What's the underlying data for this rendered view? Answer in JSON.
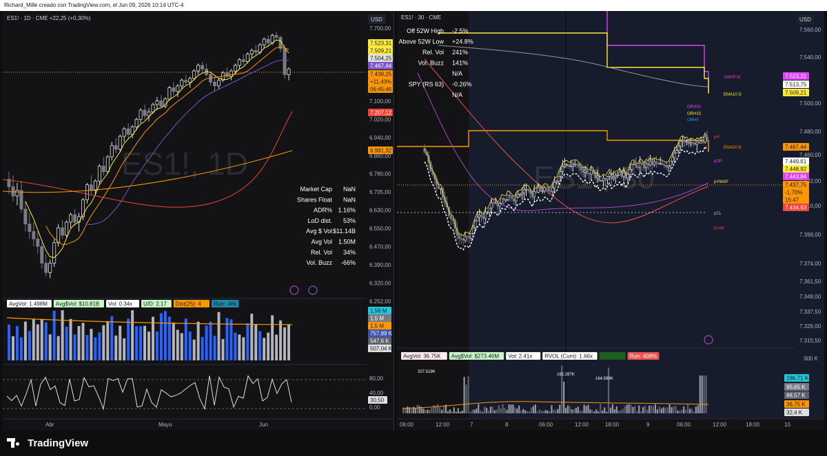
{
  "header": {
    "text": "Richard_Mille creado con TradingView.com, el Jun 09, 2026 10:14 UTC-4"
  },
  "footer": {
    "brand": "TradingView"
  },
  "left": {
    "symbol": "ES1! · 1D · CME  +22,25 (+0,30%)",
    "watermark": "ES1!, 1D",
    "currency": "USD",
    "price_ticks": [
      "7.700,00",
      "7.580,00",
      "7.440,00",
      "7.300,00",
      "7.100,00",
      "7.020,00",
      "6.940,00",
      "6.860,00",
      "6.780,00",
      "6.705,00",
      "6.630,00",
      "6.550,00",
      "6.470,00",
      "6.390,00",
      "6.320,00",
      "6.252,00"
    ],
    "price_labels": [
      {
        "text": "7.523,31",
        "bg": "#ffeb3b",
        "fg": "#131722"
      },
      {
        "text": "7.509,21",
        "bg": "#ffeb3b",
        "fg": "#131722"
      },
      {
        "text": "7.504,25",
        "bg": "#e0e0e0",
        "fg": "#131722"
      },
      {
        "text": "7.467,44",
        "bg": "#7e57c2",
        "fg": "#ffffff"
      },
      {
        "text": "7.438,25",
        "bg": "#ff9800",
        "fg": "#131722"
      },
      {
        "text": "+11,43%",
        "bg": "#ff9800",
        "fg": "#131722"
      },
      {
        "text": "06:45:46",
        "bg": "#ff9800",
        "fg": "#131722"
      },
      {
        "text": "7.207,12",
        "bg": "#f44336",
        "fg": "#ffffff"
      },
      {
        "text": "6.991,32",
        "bg": "#ff9800",
        "fg": "#131722"
      }
    ],
    "stats": [
      {
        "label": "Market Cap",
        "value": "NaN"
      },
      {
        "label": "Shares Float",
        "value": "NaN"
      },
      {
        "label": "ADR%",
        "value": "1.16%"
      },
      {
        "label": "LoD dist.",
        "value": "53%"
      },
      {
        "label": "Avg $ Vol",
        "value": "$11.14B"
      },
      {
        "label": "Avg Vol",
        "value": "1.50M"
      },
      {
        "label": "Rel. Vol",
        "value": "34%"
      },
      {
        "label": "Vol. Buzz",
        "value": "-66%"
      }
    ],
    "vol_badges": [
      {
        "text": "AvgVol: 1.498M",
        "bg": "#ffffff",
        "fg": "#131722"
      },
      {
        "text": "Avg$Vol: $10.81B",
        "bg": "#c8f7c5",
        "fg": "#131722"
      },
      {
        "text": "Vol: 0.34x",
        "bg": "#ffffff",
        "fg": "#131722"
      },
      {
        "text": "U/D: 2.17",
        "bg": "#c8f7c5",
        "fg": "#131722"
      },
      {
        "text": "Dist(25): 4",
        "bg": "#ff9800",
        "fg": "#131722"
      },
      {
        "text": "Run: -4%",
        "bg": "#1e88a8",
        "fg": "#131722"
      }
    ],
    "vol_labels": [
      {
        "text": "1,56 M",
        "bg": "#26c6da",
        "fg": "#131722"
      },
      {
        "text": "1,5 M",
        "bg": "#787b86",
        "fg": "#ffffff"
      },
      {
        "text": "1,5 M",
        "bg": "#ff9800",
        "fg": "#131722"
      },
      {
        "text": "757,89 K",
        "bg": "#3f51b5",
        "fg": "#ffffff"
      },
      {
        "text": "547,6 K",
        "bg": "#5d606b",
        "fg": "#ffffff"
      },
      {
        "text": "507,04 K",
        "bg": "#e0e0e0",
        "fg": "#131722"
      }
    ],
    "osc_ticks": [
      "80,00",
      "40,00",
      "0,00"
    ],
    "osc_label": "30,50",
    "x_labels": [
      "Abr",
      "Mayo",
      "Jun"
    ]
  },
  "right": {
    "symbol": "ES1! · 30 · CME",
    "watermark": "ES1!, 30",
    "currency": "USD",
    "price_ticks": [
      "7.560,00",
      "7.540,00",
      "7.500,00",
      "7.480,00",
      "7.460,00",
      "7.422,00",
      "7.410,00",
      "7.398,00",
      "7.374,00",
      "7.361,50",
      "7.349,00",
      "7.337,50",
      "7.326,00",
      "7.315,50"
    ],
    "price_labels": [
      {
        "text": "7.523,31",
        "bg": "#e040fb",
        "fg": "#ffffff"
      },
      {
        "text": "7.513,75",
        "bg": "#ffffff",
        "fg": "#131722"
      },
      {
        "text": "7.509,21",
        "bg": "#ffeb3b",
        "fg": "#131722"
      },
      {
        "text": "7.467,44",
        "bg": "#ff9800",
        "fg": "#131722"
      },
      {
        "text": "7.449,61",
        "bg": "#ffffff",
        "fg": "#131722"
      },
      {
        "text": "7.448,92",
        "bg": "#ffeb3b",
        "fg": "#131722"
      },
      {
        "text": "7.443,84",
        "bg": "#e040fb",
        "fg": "#ffffff"
      },
      {
        "text": "7.437,75",
        "bg": "#ff9800",
        "fg": "#131722"
      },
      {
        "text": "-1,70%",
        "bg": "#ff9800",
        "fg": "#131722"
      },
      {
        "text": "15:47",
        "bg": "#ff9800",
        "fg": "#131722"
      },
      {
        "text": "7.434,63",
        "bg": "#f44336",
        "fg": "#ffffff"
      }
    ],
    "stats": [
      {
        "label": "Off 52W High",
        "value": "-2.5%"
      },
      {
        "label": "Above 52W Low",
        "value": "+24.8%"
      },
      {
        "label": "Rel. Vol",
        "value": "241%"
      },
      {
        "label": "Vol. Buzz",
        "value": "141%"
      },
      {
        "label": "",
        "value": "N/A"
      },
      {
        "label": "SPY (RS 63)",
        "value": "-0.26%"
      },
      {
        "label": "",
        "value": "N/A"
      }
    ],
    "level_tags": [
      {
        "text": "VWAP M",
        "color": "#e040fb"
      },
      {
        "text": "EMA10 D",
        "color": "#ffeb3b"
      },
      {
        "text": "ORH30",
        "color": "#e040fb"
      },
      {
        "text": "ORH15",
        "color": "#ffeb3b"
      },
      {
        "text": "ORH5",
        "color": "#2196f3"
      },
      {
        "text": "pH",
        "color": "#f44336"
      },
      {
        "text": "EMA20 D",
        "color": "#ff9800"
      },
      {
        "text": "pOP",
        "color": "#e040fb"
      },
      {
        "text": "pVWAP",
        "color": "#ffeb3b"
      },
      {
        "text": "pCL",
        "color": "#b2b5be"
      },
      {
        "text": "pLow",
        "color": "#f44336"
      }
    ],
    "vol_badges": [
      {
        "text": "AvgVol: 36.75K",
        "bg": "#ffebee",
        "fg": "#131722"
      },
      {
        "text": "Avg$Vol: $273.46M",
        "bg": "#c8f7c5",
        "fg": "#131722"
      },
      {
        "text": "Vol: 2.41x",
        "bg": "#ffffff",
        "fg": "#131722"
      },
      {
        "text": "RVOL (Cum): 1.66x",
        "bg": "#ffffff",
        "fg": "#131722"
      },
      {
        "text": "",
        "bg": "#1b5e20",
        "fg": "#131722"
      },
      {
        "text": "Run: 408%",
        "bg": "#ef5350",
        "fg": "#ffffff"
      }
    ],
    "vol_annotations": [
      "207.519K",
      "192.287K",
      "164.599K"
    ],
    "vol_scale": "300 K",
    "vol_labels": [
      {
        "text": "186,71 K",
        "bg": "#26c6da",
        "fg": "#131722"
      },
      {
        "text": "95,65 K",
        "bg": "#787b86",
        "fg": "#ffffff"
      },
      {
        "text": "88,57 K",
        "bg": "#5d606b",
        "fg": "#ffffff"
      },
      {
        "text": "36,75 K",
        "bg": "#ff9800",
        "fg": "#131722"
      },
      {
        "text": "32,4 K",
        "bg": "#e0e0e0",
        "fg": "#131722"
      }
    ],
    "x_labels": [
      "06:00",
      "12:00",
      "7",
      "8",
      "06:00",
      "12:00",
      "18:00",
      "9",
      "06:00",
      "12:00",
      "18:00",
      "10"
    ]
  },
  "chart_data": [
    {
      "type": "candlestick",
      "title": "ES1!, 1D",
      "ylim": [
        6252,
        7700
      ],
      "series_ohlc": [
        [
          6880,
          6920,
          6800,
          6840
        ],
        [
          6840,
          6900,
          6760,
          6790
        ],
        [
          6790,
          6860,
          6740,
          6820
        ],
        [
          6820,
          6870,
          6700,
          6720
        ],
        [
          6720,
          6760,
          6600,
          6640
        ],
        [
          6640,
          6700,
          6560,
          6600
        ],
        [
          6600,
          6650,
          6520,
          6560
        ],
        [
          6560,
          6600,
          6480,
          6520
        ],
        [
          6520,
          6540,
          6400,
          6430
        ],
        [
          6430,
          6480,
          6360,
          6380
        ],
        [
          6380,
          6450,
          6350,
          6430
        ],
        [
          6430,
          6560,
          6410,
          6540
        ],
        [
          6540,
          6640,
          6520,
          6620
        ],
        [
          6620,
          6660,
          6560,
          6580
        ],
        [
          6580,
          6660,
          6570,
          6650
        ],
        [
          6650,
          6700,
          6620,
          6690
        ],
        [
          6690,
          6720,
          6630,
          6650
        ],
        [
          6650,
          6700,
          6600,
          6680
        ],
        [
          6680,
          6780,
          6660,
          6770
        ],
        [
          6770,
          6860,
          6750,
          6850
        ],
        [
          6850,
          6900,
          6800,
          6820
        ],
        [
          6820,
          6880,
          6790,
          6870
        ],
        [
          6870,
          6960,
          6850,
          6950
        ],
        [
          6950,
          7000,
          6900,
          6920
        ],
        [
          6920,
          7010,
          6910,
          7000
        ],
        [
          7000,
          7080,
          6980,
          7060
        ],
        [
          7060,
          7100,
          7020,
          7040
        ],
        [
          7040,
          7120,
          7030,
          7110
        ],
        [
          7110,
          7160,
          7080,
          7150
        ],
        [
          7150,
          7180,
          7100,
          7120
        ],
        [
          7120,
          7170,
          7100,
          7160
        ],
        [
          7160,
          7210,
          7140,
          7200
        ],
        [
          7200,
          7260,
          7180,
          7250
        ],
        [
          7250,
          7280,
          7200,
          7220
        ],
        [
          7220,
          7260,
          7190,
          7240
        ],
        [
          7240,
          7290,
          7230,
          7280
        ],
        [
          7280,
          7320,
          7250,
          7300
        ],
        [
          7300,
          7330,
          7260,
          7270
        ],
        [
          7270,
          7320,
          7260,
          7310
        ],
        [
          7310,
          7380,
          7300,
          7370
        ],
        [
          7370,
          7400,
          7330,
          7350
        ],
        [
          7350,
          7390,
          7320,
          7380
        ],
        [
          7380,
          7420,
          7360,
          7410
        ],
        [
          7410,
          7440,
          7380,
          7400
        ],
        [
          7400,
          7430,
          7370,
          7420
        ],
        [
          7420,
          7470,
          7410,
          7460
        ],
        [
          7460,
          7500,
          7440,
          7490
        ],
        [
          7490,
          7510,
          7450,
          7470
        ],
        [
          7470,
          7500,
          7430,
          7440
        ],
        [
          7440,
          7460,
          7380,
          7400
        ],
        [
          7400,
          7430,
          7350,
          7380
        ],
        [
          7380,
          7420,
          7360,
          7410
        ],
        [
          7410,
          7460,
          7400,
          7450
        ],
        [
          7450,
          7480,
          7420,
          7430
        ],
        [
          7430,
          7470,
          7410,
          7460
        ],
        [
          7460,
          7500,
          7440,
          7490
        ],
        [
          7490,
          7530,
          7470,
          7520
        ],
        [
          7520,
          7550,
          7490,
          7510
        ],
        [
          7510,
          7560,
          7500,
          7550
        ],
        [
          7550,
          7580,
          7530,
          7570
        ],
        [
          7570,
          7600,
          7540,
          7560
        ],
        [
          7560,
          7610,
          7550,
          7600
        ],
        [
          7600,
          7640,
          7580,
          7630
        ],
        [
          7630,
          7650,
          7590,
          7610
        ],
        [
          7610,
          7660,
          7600,
          7650
        ],
        [
          7650,
          7670,
          7620,
          7640
        ],
        [
          7640,
          7650,
          7560,
          7580
        ],
        [
          7580,
          7600,
          7420,
          7440
        ],
        [
          7440,
          7480,
          7410,
          7470
        ]
      ]
    },
    {
      "type": "candlestick",
      "title": "ES1!, 30",
      "ylim": [
        7315.5,
        7560
      ]
    }
  ]
}
